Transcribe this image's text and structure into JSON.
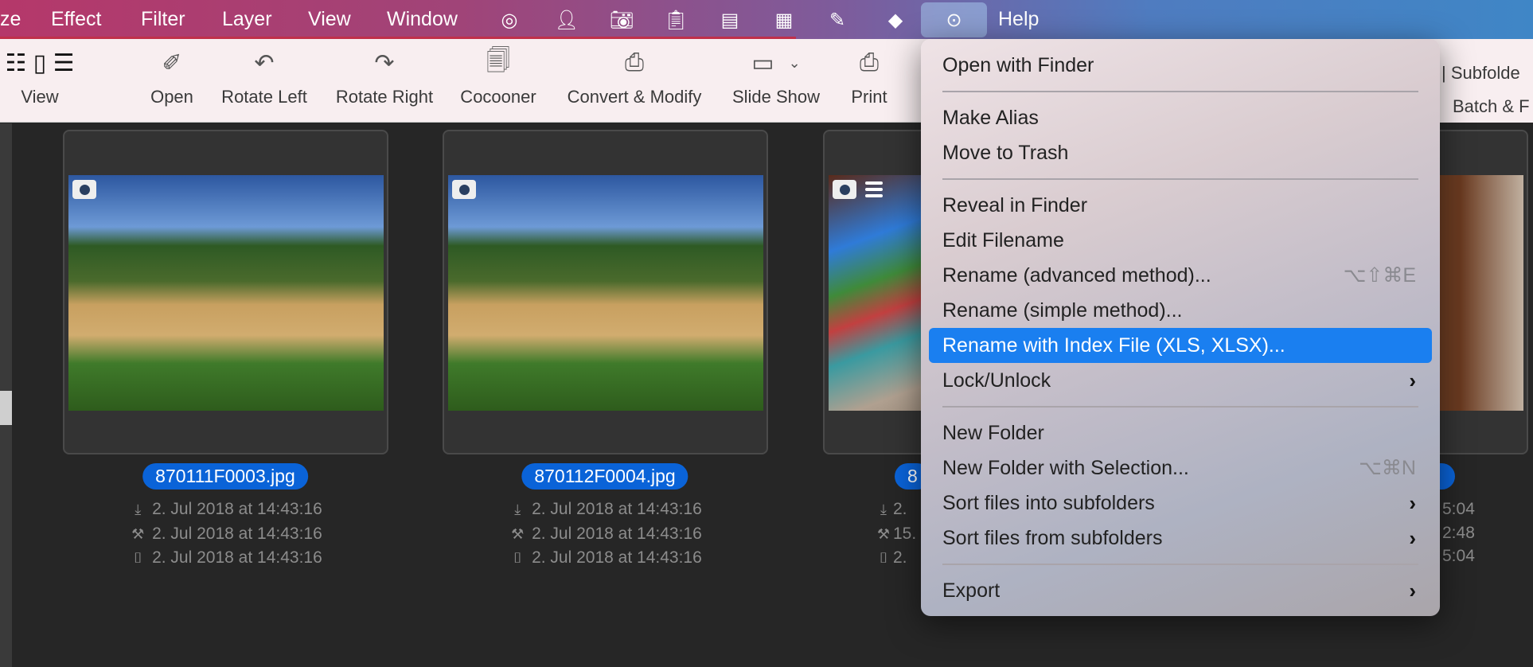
{
  "menubar": {
    "items": [
      "ze",
      "Effect",
      "Filter",
      "Layer",
      "View",
      "Window"
    ],
    "icons": [
      "target-icon",
      "person-icon",
      "camera-icon",
      "clipboard-icon",
      "box-icon",
      "calendar-icon",
      "pin-icon",
      "tag-icon"
    ],
    "more_icon": "ellipsis-circle-icon",
    "help": "Help"
  },
  "toolbar": {
    "view": "View",
    "open": "Open",
    "rotate_left": "Rotate Left",
    "rotate_right": "Rotate Right",
    "cocooner": "Cocooner",
    "convert": "Convert & Modify",
    "slideshow": "Slide Show",
    "print": "Print",
    "subfolders": "| Subfolde",
    "batch": "Batch & F"
  },
  "files": [
    {
      "name": "870111F0003.jpg",
      "dates": [
        "2. Jul 2018 at 14:43:16",
        "2. Jul 2018 at 14:43:16",
        "2. Jul 2018 at 14:43:16"
      ]
    },
    {
      "name": "870112F0004.jpg",
      "dates": [
        "2. Jul 2018 at 14:43:16",
        "2. Jul 2018 at 14:43:16",
        "2. Jul 2018 at 14:43:16"
      ]
    },
    {
      "name": "8",
      "dates": [
        "2.",
        "15.",
        "2."
      ]
    },
    {
      "dates": [
        "5:04",
        "2:48",
        "5:04"
      ]
    }
  ],
  "context_menu": {
    "open_finder": "Open with Finder",
    "make_alias": "Make Alias",
    "trash": "Move to Trash",
    "reveal": "Reveal in Finder",
    "edit_filename": "Edit Filename",
    "rename_adv": "Rename (advanced method)...",
    "rename_adv_shortcut": "⌥⇧⌘E",
    "rename_simple": "Rename (simple method)...",
    "rename_index": "Rename with Index File (XLS, XLSX)...",
    "lock": "Lock/Unlock",
    "new_folder": "New Folder",
    "new_folder_sel": "New Folder with Selection...",
    "new_folder_sel_shortcut": "⌥⌘N",
    "sort_into": "Sort files into subfolders",
    "sort_from": "Sort files from subfolders",
    "export": "Export"
  },
  "colors": {
    "selection": "#0a63d8",
    "highlight": "#1a7ff0"
  }
}
